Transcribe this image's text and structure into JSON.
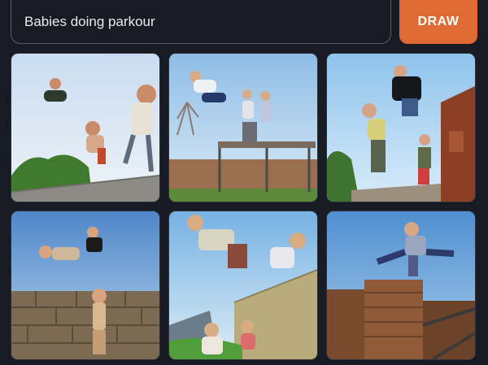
{
  "prompt": {
    "value": "Babies doing parkour"
  },
  "draw_button": {
    "label": "DRAW"
  },
  "colors": {
    "background": "#181b23",
    "accent": "#e06a34",
    "input_border": "#5a5f6b"
  },
  "results": [
    {
      "name": "generated-image-1"
    },
    {
      "name": "generated-image-2"
    },
    {
      "name": "generated-image-3"
    },
    {
      "name": "generated-image-4"
    },
    {
      "name": "generated-image-5"
    },
    {
      "name": "generated-image-6"
    }
  ]
}
